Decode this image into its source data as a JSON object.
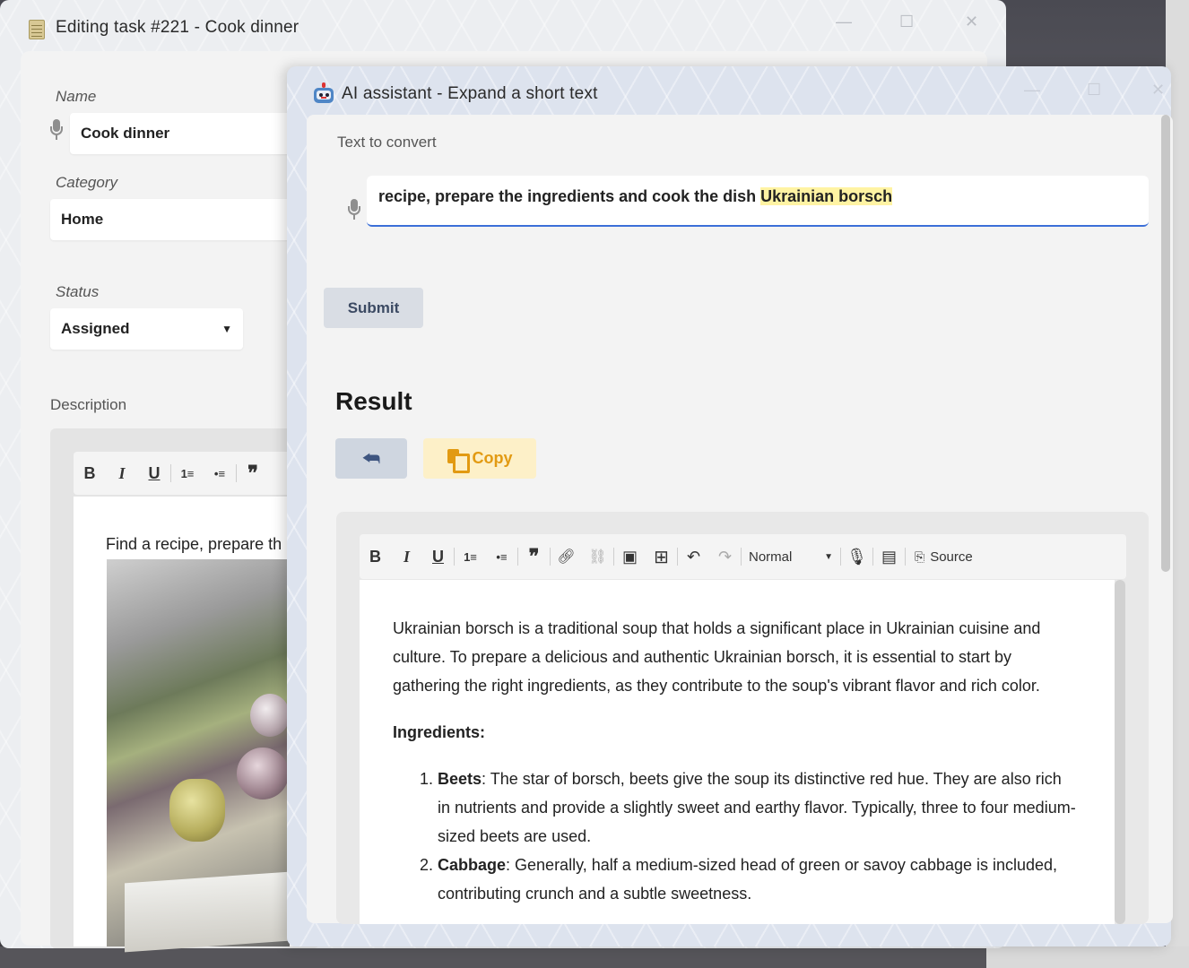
{
  "back_window": {
    "title": "Editing task #221 - Cook dinner",
    "name_label": "Name",
    "name_value": "Cook dinner",
    "category_label": "Category",
    "category_value": "Home",
    "status_label": "Status",
    "status_value": "Assigned",
    "status_arrow": "▼",
    "description_label": "Description",
    "description_text": "Find a recipe, prepare th",
    "toolbar": [
      "B",
      "I",
      "U",
      "1≡",
      "•≡",
      "❞"
    ]
  },
  "front_window": {
    "title": "AI assistant - Expand a short text",
    "text_to_convert_label": "Text to convert",
    "input_text_plain": "recipe, prepare the ingredients and cook the dish ",
    "input_text_highlight": "Ukrainian borsch",
    "submit_label": "Submit",
    "result_heading": "Result",
    "copy_label": "Copy",
    "editor_toolbar": {
      "bold": "B",
      "italic": "I",
      "underline": "U",
      "format_value": "Normal",
      "source_label": "Source"
    },
    "content": {
      "intro": "Ukrainian borsch is a traditional soup that holds a significant place in Ukrainian cuisine and culture. To prepare a delicious and authentic Ukrainian borsch, it is essential to start by gathering the right ingredients, as they contribute to the soup's vibrant flavor and rich color.",
      "ingredients_heading": "Ingredients:",
      "items": [
        {
          "term": "Beets",
          "text": ": The star of borsch, beets give the soup its distinctive red hue. They are also rich in nutrients and provide a slightly sweet and earthy flavor. Typically, three to four medium-sized beets are used."
        },
        {
          "term": "Cabbage",
          "text": ": Generally, half a medium-sized head of green or savoy cabbage is included, contributing crunch and a subtle sweetness."
        }
      ]
    }
  },
  "colors": {
    "accent_blue": "#3b6fd8",
    "highlight_yellow": "#fff3a3",
    "copy_orange": "#e29a12"
  }
}
